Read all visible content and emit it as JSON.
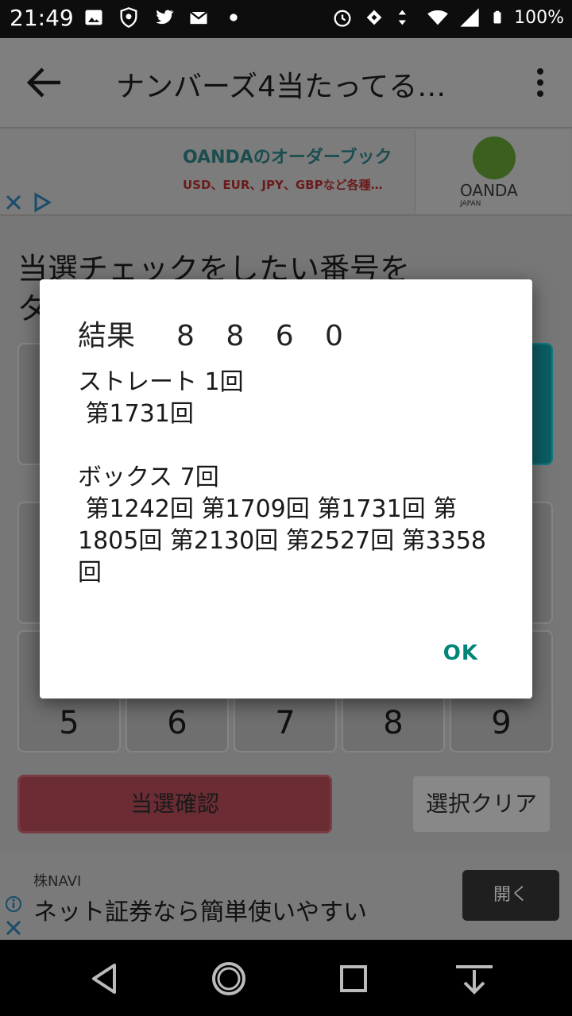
{
  "status_bar": {
    "time": "21:49",
    "battery": "100%",
    "left_icons": [
      "image-icon",
      "shield-icon",
      "twitter-icon",
      "mail-icon",
      "dot-icon"
    ],
    "right_icons": [
      "alarm-icon",
      "sync-icon",
      "data-icon",
      "wifi-icon",
      "signal-icon",
      "battery-icon"
    ]
  },
  "app_bar": {
    "title": "ナンバーズ4当たってる…"
  },
  "top_ad": {
    "title": "OANDAのオーダーブック",
    "subtitle": "USD、EUR、JPY、GBPなど各種…",
    "logo_text": "OANDA",
    "logo_sub": "JAPAN"
  },
  "main": {
    "heading_line1": "当選チェックをしたい番号を",
    "heading_line2": "タ",
    "keys": [
      {
        "label": "",
        "selected": false
      },
      {
        "label": "",
        "selected": false
      },
      {
        "label": "",
        "selected": false
      },
      {
        "label": "",
        "selected": false
      },
      {
        "label": "",
        "selected": true
      },
      {
        "label": "",
        "selected": false
      },
      {
        "label": "",
        "selected": false
      },
      {
        "label": "",
        "selected": false
      },
      {
        "label": "",
        "selected": false
      },
      {
        "label": "",
        "selected": false
      },
      {
        "label": "5",
        "selected": false
      },
      {
        "label": "6",
        "selected": false
      },
      {
        "label": "7",
        "selected": false
      },
      {
        "label": "8",
        "selected": false
      },
      {
        "label": "9",
        "selected": false
      }
    ],
    "check_button": "当選確認",
    "clear_button": "選択クリア"
  },
  "bottom_ad": {
    "brand": "株NAVI",
    "text": "ネット証券なら簡単使いやすい",
    "open_button": "開く"
  },
  "dialog": {
    "title_label": "結果",
    "number": "8 8 6 0",
    "straight_label": "ストレート 1回",
    "straight_draws": " 第1731回",
    "box_label": "ボックス 7回",
    "box_draws_line1": " 第1242回 第1709回 第1731回 第",
    "box_draws_line2": "1805回 第2130回 第2527回 第3358",
    "box_draws_line3": "回",
    "ok_button": "OK"
  }
}
